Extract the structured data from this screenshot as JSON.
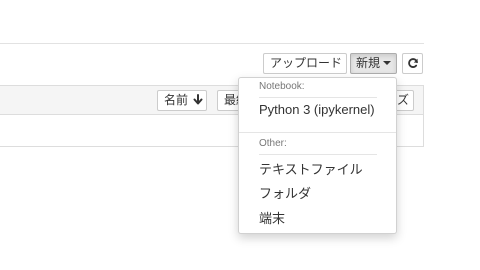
{
  "toolbar": {
    "upload_label": "アップロード",
    "new_label": "新規",
    "refresh_icon": "refresh-icon"
  },
  "list_header": {
    "name_label": "名前",
    "sort_icon": "arrow-down-icon",
    "modified_label": "最終",
    "size_label": "ズ"
  },
  "new_menu": {
    "notebook_header": "Notebook:",
    "notebook_items": [
      {
        "label": "Python 3 (ipykernel)"
      }
    ],
    "other_header": "Other:",
    "other_items": [
      {
        "label": "テキストファイル"
      },
      {
        "label": "フォルダ"
      },
      {
        "label": "端末"
      }
    ]
  }
}
